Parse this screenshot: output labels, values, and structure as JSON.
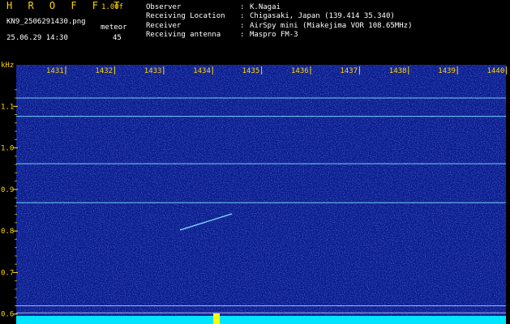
{
  "header": {
    "brand": "H R O F F T",
    "version": "1.00f",
    "filename": "KN9_2506291430.png",
    "datetime": "25.06.29 14:30",
    "meteor_label": "meteor",
    "meteor_count": "45"
  },
  "info": [
    {
      "label": "Observer",
      "colon": ":",
      "value": "K.Nagai"
    },
    {
      "label": "Receiving Location",
      "colon": ":",
      "value": "Chigasaki, Japan (139.414 35.340)"
    },
    {
      "label": "Receiver",
      "colon": ":",
      "value": "AirSpy mini (Miakejima VOR 108.65MHz)"
    },
    {
      "label": "Receiving antenna",
      "colon": ":",
      "value": "Maspro FM-3"
    }
  ],
  "chart_data": {
    "type": "heatmap",
    "ylabel": "kHz",
    "x_ticks": [
      "1431",
      "1432",
      "1433",
      "1434",
      "1435",
      "1436",
      "1437",
      "1438",
      "1439",
      "1440"
    ],
    "y_ticks": [
      "1.1",
      "1.0",
      "0.9",
      "0.8",
      "0.7",
      "0.6"
    ],
    "ylim": [
      0.58,
      1.2
    ],
    "horizontal_lines_khz": [
      1.12,
      1.076,
      0.962,
      0.868,
      0.62,
      0.603
    ],
    "colors": {
      "background": "#0b1a8c",
      "noise": "#2f5bd8",
      "carrier": "#7fe0ff",
      "bottom_band": "#00e5ff"
    }
  }
}
